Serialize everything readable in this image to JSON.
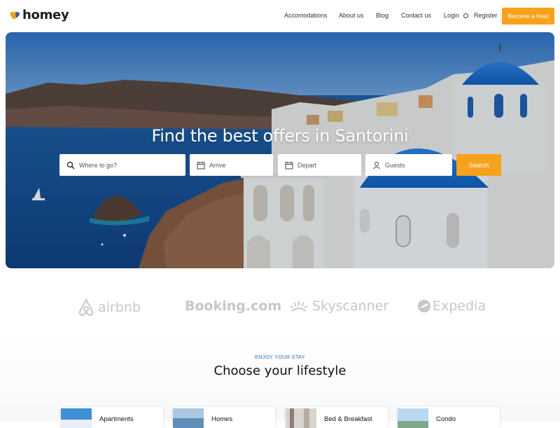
{
  "brand": {
    "name": "homey",
    "accent": "#f7a21b",
    "mark_color": "#f7a21b"
  },
  "nav": {
    "links": [
      "Accomodations",
      "About us",
      "Blog",
      "Contact us"
    ],
    "login": "Login",
    "register": "Register",
    "host_button": "Become a Host"
  },
  "hero": {
    "title": "Find the best offers in Santorini",
    "where_placeholder": "Where to go?",
    "arrive_placeholder": "Arrive",
    "depart_placeholder": "Depart",
    "guests_placeholder": "Guests",
    "search_label": "Search"
  },
  "partners": [
    "airbnb",
    "Booking.com",
    "Skyscanner",
    "Expedia"
  ],
  "lifestyle": {
    "eyebrow": "ENJOY YOUR STAY",
    "title": "Choose your lifestyle",
    "cards": [
      "Apartments",
      "Homes",
      "Bed & Breakfast",
      "Condo"
    ]
  }
}
